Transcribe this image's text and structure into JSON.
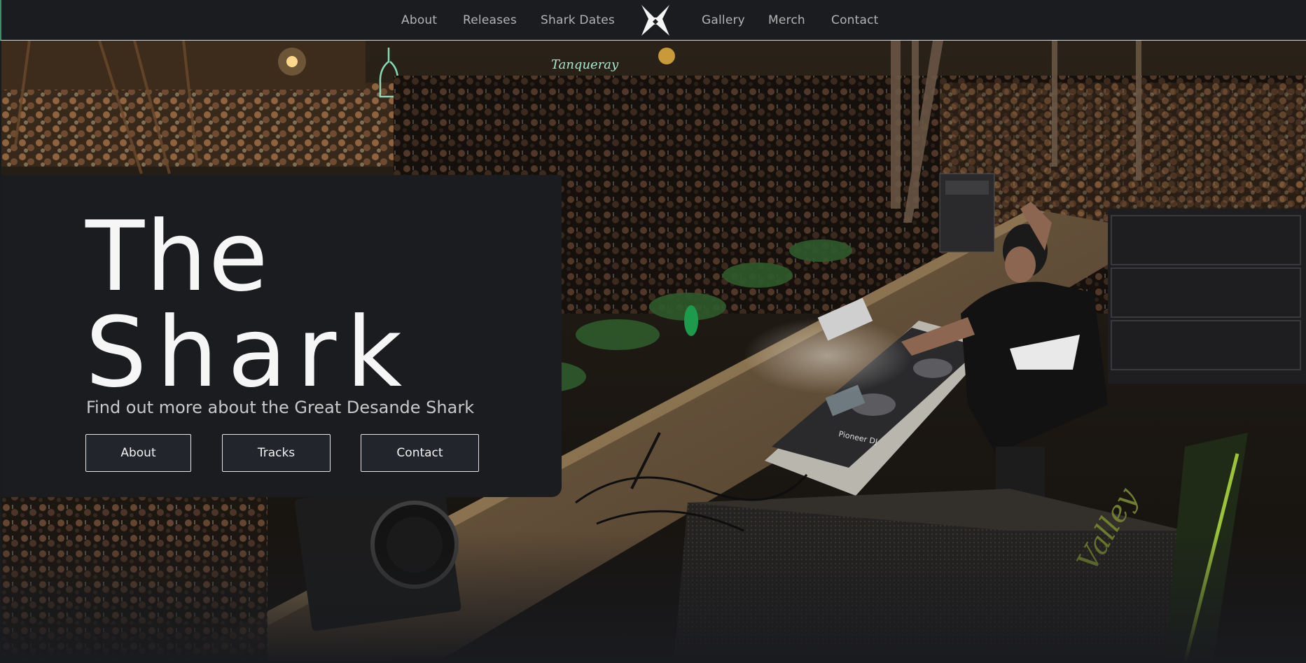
{
  "nav": {
    "left_links": [
      "About",
      "Releases",
      "Shark Dates"
    ],
    "right_links": [
      "Gallery",
      "Merch",
      "Contact"
    ],
    "logo_icon": "shark-x-logo-icon"
  },
  "hero": {
    "title_line1": "The",
    "title_line2": "Shark",
    "subtitle": "Find out more about the Great Desande Shark",
    "buttons": [
      "About",
      "Tracks",
      "Contact"
    ],
    "background": {
      "description_icon": "concert-crowd-dj-photo",
      "venue_sign": "Tanqueray",
      "equipment_label": "Pioneer DJ"
    }
  },
  "colors": {
    "background": "#1b1c20",
    "button_bg": "#23252d",
    "text": "#f6f6f6",
    "nav_text": "#b3b3b3",
    "accent_green": "#3a8f6a"
  }
}
